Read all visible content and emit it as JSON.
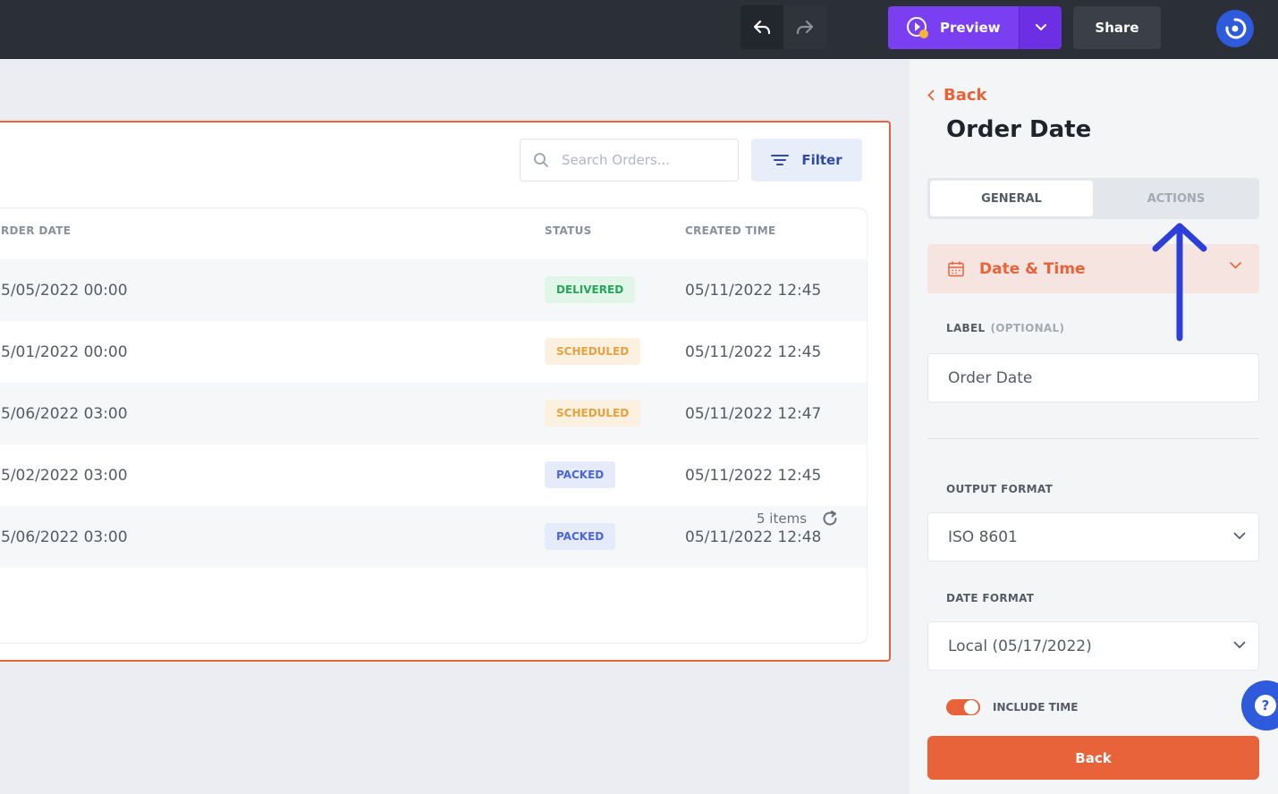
{
  "topbar": {
    "preview_label": "Preview",
    "share_label": "Share"
  },
  "search": {
    "placeholder": "Search Orders..."
  },
  "filter_label": "Filter",
  "table": {
    "columns": [
      "RDER DATE",
      "STATUS",
      "CREATED TIME"
    ],
    "rows": [
      {
        "order_date": "5/05/2022 00:00",
        "status": "DELIVERED",
        "created": "05/11/2022 12:45"
      },
      {
        "order_date": "5/01/2022 00:00",
        "status": "SCHEDULED",
        "created": "05/11/2022 12:45"
      },
      {
        "order_date": "5/06/2022 03:00",
        "status": "SCHEDULED",
        "created": "05/11/2022 12:47"
      },
      {
        "order_date": "5/02/2022 03:00",
        "status": "PACKED",
        "created": "05/11/2022 12:45"
      },
      {
        "order_date": "5/06/2022 03:00",
        "status": "PACKED",
        "created": "05/11/2022 12:48"
      }
    ],
    "items_count": "5 items"
  },
  "panel": {
    "back_link": "Back",
    "title": "Order Date",
    "tabs": [
      "GENERAL",
      "ACTIONS"
    ],
    "field_type": "Date & Time",
    "label_field": {
      "label": "LABEL",
      "optional": "(OPTIONAL)",
      "value": "Order Date"
    },
    "output_format": {
      "label": "OUTPUT FORMAT",
      "value": "ISO 8601"
    },
    "date_format": {
      "label": "DATE FORMAT",
      "value": "Local (05/17/2022)"
    },
    "include_time_label": "INCLUDE TIME",
    "back_button": "Back"
  },
  "help_label": "?",
  "colors": {
    "accent": "#e8623a",
    "preview": "#7b3ff2",
    "delivered": "#27a55a",
    "scheduled": "#e9a13b",
    "packed": "#4a66d8",
    "annotation_arrow": "#2d3fd8"
  }
}
